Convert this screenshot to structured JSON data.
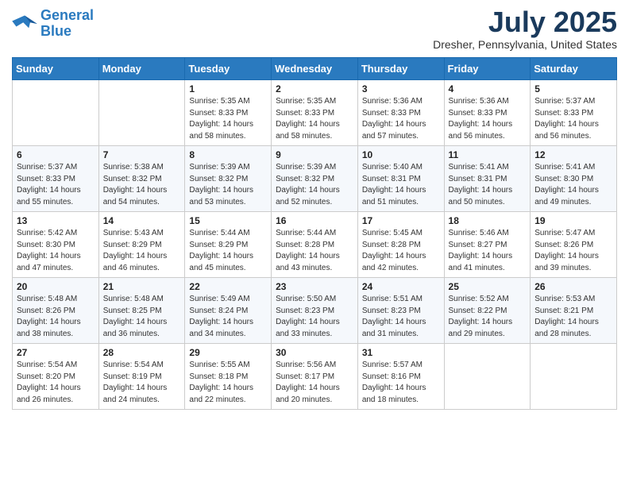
{
  "logo": {
    "line1": "General",
    "line2": "Blue"
  },
  "title": "July 2025",
  "location": "Dresher, Pennsylvania, United States",
  "weekdays": [
    "Sunday",
    "Monday",
    "Tuesday",
    "Wednesday",
    "Thursday",
    "Friday",
    "Saturday"
  ],
  "weeks": [
    [
      {
        "day": null
      },
      {
        "day": null
      },
      {
        "day": "1",
        "sunrise": "5:35 AM",
        "sunset": "8:33 PM",
        "daylight": "14 hours and 58 minutes."
      },
      {
        "day": "2",
        "sunrise": "5:35 AM",
        "sunset": "8:33 PM",
        "daylight": "14 hours and 58 minutes."
      },
      {
        "day": "3",
        "sunrise": "5:36 AM",
        "sunset": "8:33 PM",
        "daylight": "14 hours and 57 minutes."
      },
      {
        "day": "4",
        "sunrise": "5:36 AM",
        "sunset": "8:33 PM",
        "daylight": "14 hours and 56 minutes."
      },
      {
        "day": "5",
        "sunrise": "5:37 AM",
        "sunset": "8:33 PM",
        "daylight": "14 hours and 56 minutes."
      }
    ],
    [
      {
        "day": "6",
        "sunrise": "5:37 AM",
        "sunset": "8:33 PM",
        "daylight": "14 hours and 55 minutes."
      },
      {
        "day": "7",
        "sunrise": "5:38 AM",
        "sunset": "8:32 PM",
        "daylight": "14 hours and 54 minutes."
      },
      {
        "day": "8",
        "sunrise": "5:39 AM",
        "sunset": "8:32 PM",
        "daylight": "14 hours and 53 minutes."
      },
      {
        "day": "9",
        "sunrise": "5:39 AM",
        "sunset": "8:32 PM",
        "daylight": "14 hours and 52 minutes."
      },
      {
        "day": "10",
        "sunrise": "5:40 AM",
        "sunset": "8:31 PM",
        "daylight": "14 hours and 51 minutes."
      },
      {
        "day": "11",
        "sunrise": "5:41 AM",
        "sunset": "8:31 PM",
        "daylight": "14 hours and 50 minutes."
      },
      {
        "day": "12",
        "sunrise": "5:41 AM",
        "sunset": "8:30 PM",
        "daylight": "14 hours and 49 minutes."
      }
    ],
    [
      {
        "day": "13",
        "sunrise": "5:42 AM",
        "sunset": "8:30 PM",
        "daylight": "14 hours and 47 minutes."
      },
      {
        "day": "14",
        "sunrise": "5:43 AM",
        "sunset": "8:29 PM",
        "daylight": "14 hours and 46 minutes."
      },
      {
        "day": "15",
        "sunrise": "5:44 AM",
        "sunset": "8:29 PM",
        "daylight": "14 hours and 45 minutes."
      },
      {
        "day": "16",
        "sunrise": "5:44 AM",
        "sunset": "8:28 PM",
        "daylight": "14 hours and 43 minutes."
      },
      {
        "day": "17",
        "sunrise": "5:45 AM",
        "sunset": "8:28 PM",
        "daylight": "14 hours and 42 minutes."
      },
      {
        "day": "18",
        "sunrise": "5:46 AM",
        "sunset": "8:27 PM",
        "daylight": "14 hours and 41 minutes."
      },
      {
        "day": "19",
        "sunrise": "5:47 AM",
        "sunset": "8:26 PM",
        "daylight": "14 hours and 39 minutes."
      }
    ],
    [
      {
        "day": "20",
        "sunrise": "5:48 AM",
        "sunset": "8:26 PM",
        "daylight": "14 hours and 38 minutes."
      },
      {
        "day": "21",
        "sunrise": "5:48 AM",
        "sunset": "8:25 PM",
        "daylight": "14 hours and 36 minutes."
      },
      {
        "day": "22",
        "sunrise": "5:49 AM",
        "sunset": "8:24 PM",
        "daylight": "14 hours and 34 minutes."
      },
      {
        "day": "23",
        "sunrise": "5:50 AM",
        "sunset": "8:23 PM",
        "daylight": "14 hours and 33 minutes."
      },
      {
        "day": "24",
        "sunrise": "5:51 AM",
        "sunset": "8:23 PM",
        "daylight": "14 hours and 31 minutes."
      },
      {
        "day": "25",
        "sunrise": "5:52 AM",
        "sunset": "8:22 PM",
        "daylight": "14 hours and 29 minutes."
      },
      {
        "day": "26",
        "sunrise": "5:53 AM",
        "sunset": "8:21 PM",
        "daylight": "14 hours and 28 minutes."
      }
    ],
    [
      {
        "day": "27",
        "sunrise": "5:54 AM",
        "sunset": "8:20 PM",
        "daylight": "14 hours and 26 minutes."
      },
      {
        "day": "28",
        "sunrise": "5:54 AM",
        "sunset": "8:19 PM",
        "daylight": "14 hours and 24 minutes."
      },
      {
        "day": "29",
        "sunrise": "5:55 AM",
        "sunset": "8:18 PM",
        "daylight": "14 hours and 22 minutes."
      },
      {
        "day": "30",
        "sunrise": "5:56 AM",
        "sunset": "8:17 PM",
        "daylight": "14 hours and 20 minutes."
      },
      {
        "day": "31",
        "sunrise": "5:57 AM",
        "sunset": "8:16 PM",
        "daylight": "14 hours and 18 minutes."
      },
      {
        "day": null
      },
      {
        "day": null
      }
    ]
  ],
  "labels": {
    "sunrise": "Sunrise:",
    "sunset": "Sunset:",
    "daylight": "Daylight:"
  }
}
